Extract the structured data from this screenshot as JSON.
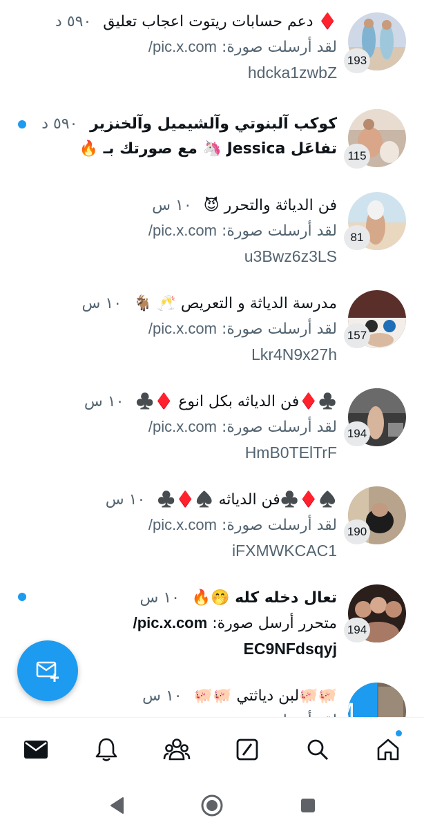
{
  "conversations": [
    {
      "title": "دعم حسابات ريتوت اعجاب تعليق",
      "title_emoji": "♦️",
      "time": "٥٩٠ د",
      "preview": "لقد أرسلت صورة:",
      "url": "pic.x.com/",
      "url2": "hdcka1zwbZ",
      "count": "193",
      "unread": false
    },
    {
      "title": "كوكب آلبنوتي وآلشيميل وآلخنزير",
      "time": "٥٩٠ د",
      "preview": "تفاعَل Jessica 🦄 مع صورتك بـ 🔥",
      "count": "115",
      "unread": true
    },
    {
      "title": "فن الدياثة والتحرر 😈",
      "time": "١٠ س",
      "preview": "لقد أرسلت صورة:",
      "url": "pic.x.com/",
      "url2": "u3Bwz6z3LS",
      "count": "81",
      "unread": false
    },
    {
      "title": "مدرسة الدياثة و التعريص 🥂 🐐",
      "time": "١٠ س",
      "preview": "لقد أرسلت صورة:",
      "url": "pic.x.com/",
      "url2": "Lkr4N9x27h",
      "count": "157",
      "unread": false
    },
    {
      "title": "♣️♦️فن الدياثه بكل انوع ♦️♣️",
      "time": "١٠ س",
      "preview": "لقد أرسلت صورة:",
      "url": "pic.x.com/",
      "url2": "HmB0TElTrF",
      "count": "194",
      "unread": false
    },
    {
      "title": "♠️♦️♣️فن الدياثه ♠️♦️♣️",
      "time": "١٠ س",
      "preview": "لقد أرسلت صورة:",
      "url": "pic.x.com/",
      "url2": "iFXMWKCAC1",
      "count": "190",
      "unread": false
    },
    {
      "title": "تعال دخله كله 🤭🔥",
      "time": "١٠ س",
      "preview": "متحرر أرسل صورة:",
      "url": "pic.x.com/",
      "url2": "EC9NFdsqyj",
      "count": "194",
      "unread": true
    },
    {
      "title": "🐖🐖لبن دياثتي 🐖🐖",
      "time": "١٠ س",
      "preview": "لقد أرسلت صورة:",
      "count": "",
      "unread": false
    }
  ],
  "tabs": {
    "home": "home-icon",
    "search": "search-icon",
    "grok": "grok-icon",
    "communities": "communities-icon",
    "notifications": "bell-icon",
    "messages": "mail-icon"
  },
  "colors": {
    "accent": "#1d9bf0",
    "text": "#0f1419",
    "secondary": "#536471"
  }
}
